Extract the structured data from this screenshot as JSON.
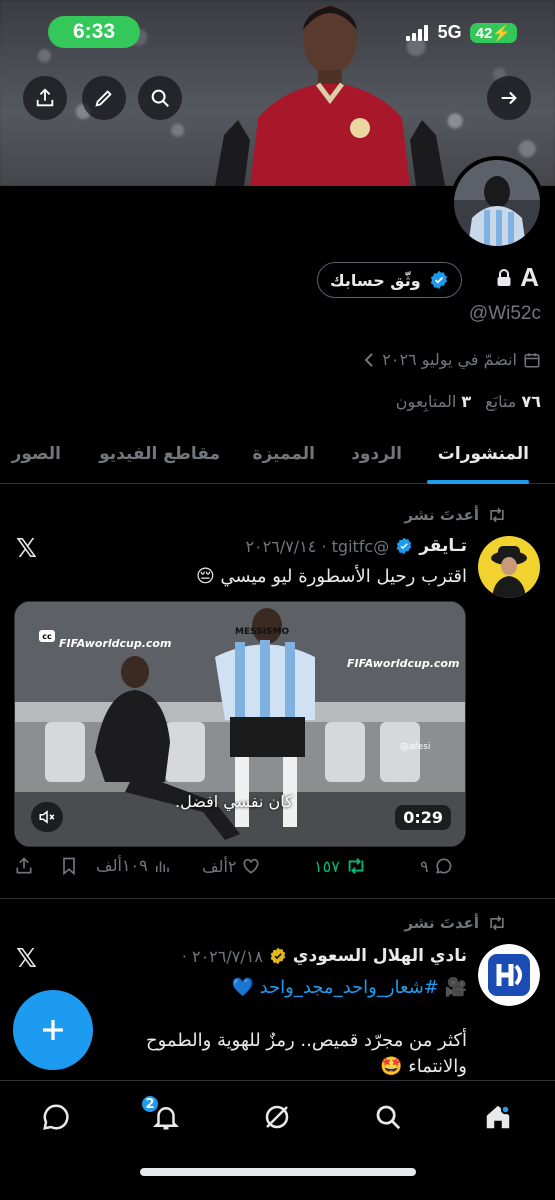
{
  "status_bar": {
    "time": "6:33",
    "network": "5G",
    "battery": "42"
  },
  "banner": {
    "icons": [
      "share-icon",
      "edit-icon",
      "search-icon",
      "forward-icon"
    ]
  },
  "profile": {
    "name": "A",
    "verify_label": "وثّق حسابك",
    "handle": "@Wi52c",
    "joined": "انضمّ في يوليو ٢٠٢٦",
    "following_count": "٧٦",
    "following_label": "متابَع",
    "followers_count": "٣",
    "followers_label": "المتابِعون"
  },
  "tabs": [
    "المنشورات",
    "الردود",
    "المميزة",
    "مقاطع الفيديو",
    "الصور"
  ],
  "tweets": [
    {
      "repost_label": "أعدتَ نشر",
      "name": "تـايقر",
      "meta": "@tgitfc · ٢٠٢٦/٧/١٤",
      "text": "اقترب رحيل الأسطورة ليو ميسي 😔",
      "video": {
        "duration": "0:29",
        "caption": "كان نفسي افضل.",
        "watermark": "FIFAworldcup.com",
        "badge": "cc",
        "shirt_text": "MESSISMO",
        "credit": "@afesi"
      },
      "stats": {
        "replies": "٩",
        "reposts": "١٥٧",
        "likes": "٢ألف",
        "views": "١٠٩ألف"
      }
    },
    {
      "repost_label": "أعدتَ نشر",
      "name": "نادي الهلال السعودي",
      "meta": "٢٠٢٦/٧/١٨ ·",
      "hashtag": "🎥 #شعار_واحد_مجد_واحد 💙",
      "text_line1": "أكثر من مجرّد قميص.. رمزٌ للهوية والطموح",
      "text_line2": "والانتماء 🤩"
    }
  ],
  "nav": {
    "notification_count": "2"
  },
  "colors": {
    "accent": "#1d9bf0",
    "repost_green": "#00ba7c",
    "status_green": "#34c759",
    "gold_badge": "#e2b719"
  }
}
